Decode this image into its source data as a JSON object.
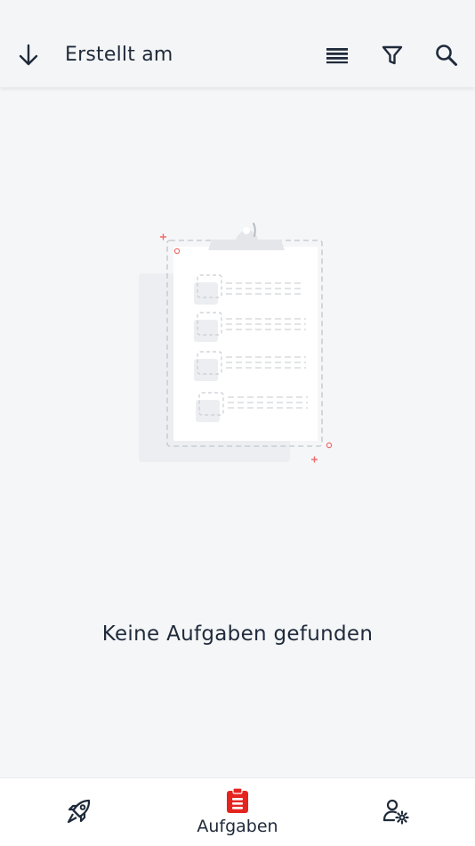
{
  "topbar": {
    "sort_label": "Erstellt am",
    "icons": [
      "arrow-down-icon",
      "list-view-icon",
      "filter-icon",
      "search-icon"
    ]
  },
  "empty_state": {
    "message": "Keine Aufgaben gefunden",
    "illustration": "clipboard-empty-icon"
  },
  "bottom_nav": {
    "items": [
      {
        "icon": "rocket-icon",
        "label": ""
      },
      {
        "icon": "clipboard-icon",
        "label": "Aufgaben",
        "active": true
      },
      {
        "icon": "user-settings-icon",
        "label": ""
      }
    ]
  },
  "colors": {
    "accent": "#e52420",
    "text": "#1f2a3a",
    "background": "#f5f6f8",
    "bar": "#ffffff"
  }
}
